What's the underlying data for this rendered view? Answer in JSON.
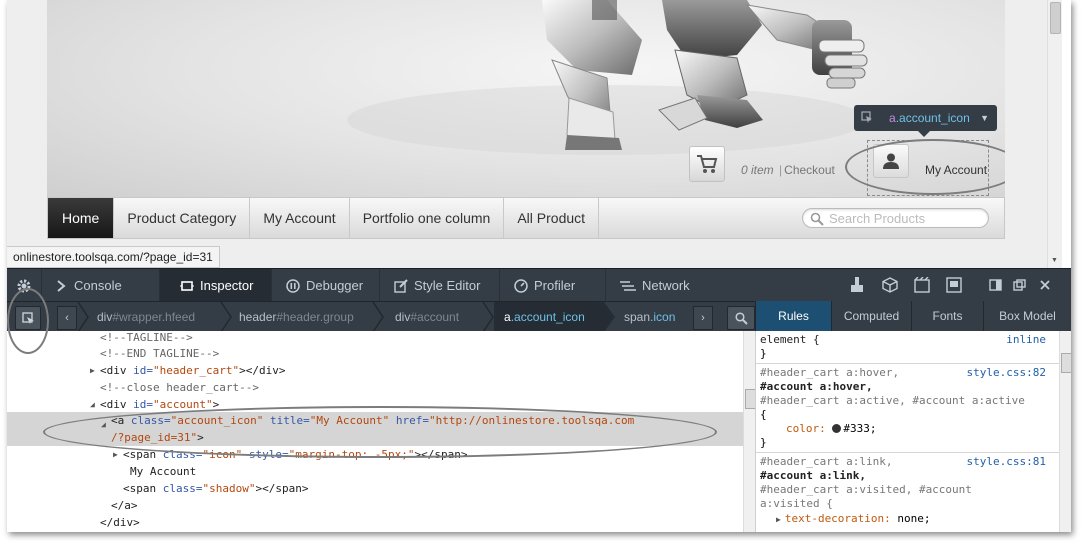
{
  "page": {
    "cart": {
      "count": "0 item",
      "separator": "|",
      "checkout": "Checkout"
    },
    "account_label": "My Account",
    "highlighter_tooltip": {
      "tag": "a",
      "class": ".account_icon"
    },
    "nav": [
      "Home",
      "Product Category",
      "My Account",
      "Portfolio one column",
      "All Product"
    ],
    "search_placeholder": "Search Products",
    "status_url": "onlinestore.toolsqa.com/?page_id=31"
  },
  "devtools": {
    "tabs": [
      "Console",
      "Inspector",
      "Debugger",
      "Style Editor",
      "Profiler",
      "Network"
    ],
    "active_tab": "Inspector",
    "breadcrumbs": [
      {
        "tag": "div",
        "id": "#wrapper.hfeed"
      },
      {
        "tag": "header",
        "id": "#header.group"
      },
      {
        "tag": "div",
        "id": "#account"
      },
      {
        "tag": "a",
        "cls": ".account_icon"
      },
      {
        "tag": "span",
        "cls": ".icon"
      }
    ],
    "side_tabs": [
      "Rules",
      "Computed",
      "Fonts",
      "Box Model"
    ],
    "markup": {
      "l1": "<!--TAGLINE-->",
      "l2": "<!--END TAGLINE-->",
      "l3_open": "<div ",
      "l3_attr": "id=",
      "l3_val": "\"header_cart\"",
      "l3_close": "></div>",
      "l4": "<!--close header_cart-->",
      "l5_open": "<div ",
      "l5_attr": "id=",
      "l5_val": "\"account\"",
      "l5_close": ">",
      "l6_open": "<a ",
      "l6_a1": "class=",
      "l6_v1": "\"account_icon\"",
      "l6_a2": "title=",
      "l6_v2": "\"My Account\"",
      "l6_a3": "href=",
      "l6_v3": "\"http://onlinestore.toolsqa.com",
      "l7_v": "/?page_id=31\"",
      "l7_close": ">",
      "l8_open": "<span ",
      "l8_a1": "class=",
      "l8_v1": "\"icon\"",
      "l8_a2": "style=",
      "l8_v2": "\"margin-top: -5px;\"",
      "l8_close": "></span>",
      "l9": "My Account",
      "l10_open": "<span ",
      "l10_a1": "class=",
      "l10_v1": "\"shadow\"",
      "l10_close": "></span>",
      "l11": "</a>",
      "l12": "</div>"
    },
    "rules": {
      "r1_sel": "element {",
      "r1_src": "inline",
      "r1_end": "}",
      "r2_s1": "#header_cart a:hover,",
      "r2_src": "style.css:82",
      "r2_s2": "#account a:hover,",
      "r2_s3": "#header_cart a:active, #account a:active",
      "r2_open": "{",
      "r2_prop": "color:",
      "r2_val": "#333;",
      "r2_end": "}",
      "r3_s1": "#header_cart a:link,",
      "r3_src": "style.css:81",
      "r3_s2": "#account a:link,",
      "r3_s3": "#header_cart a:visited, #account",
      "r3_s4": "a:visited {",
      "r3_prop": "text-decoration:",
      "r3_val": "none;"
    }
  }
}
